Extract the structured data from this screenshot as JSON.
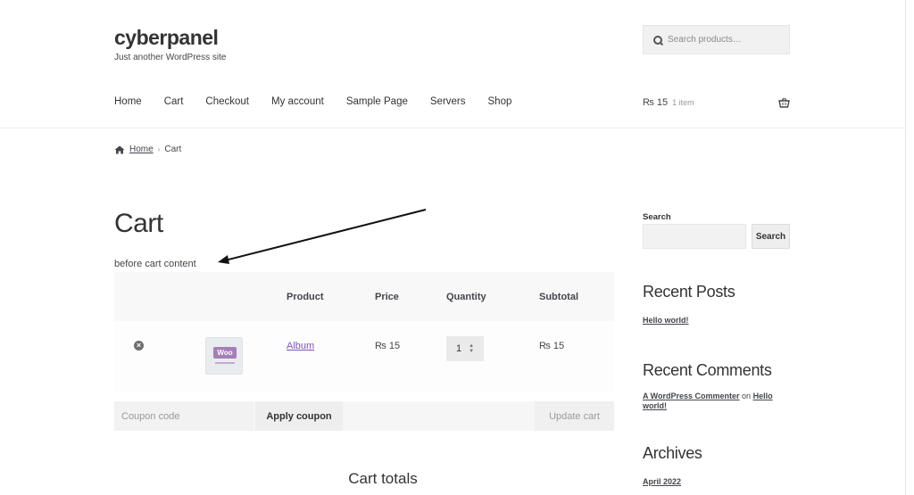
{
  "site": {
    "title": "cyberpanel",
    "tagline": "Just another WordPress site"
  },
  "header_search": {
    "placeholder": "Search products…"
  },
  "nav": [
    "Home",
    "Cart",
    "Checkout",
    "My account",
    "Sample Page",
    "Servers",
    "Shop"
  ],
  "mini_cart": {
    "amount": "₨ 15",
    "count": "1 item"
  },
  "breadcrumb": {
    "home": "Home",
    "sep": "›",
    "current": "Cart"
  },
  "page": {
    "title": "Cart",
    "before_cart": "before cart content"
  },
  "cart": {
    "headers": {
      "product": "Product",
      "price": "Price",
      "quantity": "Quantity",
      "subtotal": "Subtotal"
    },
    "items": [
      {
        "remove": "×",
        "thumb_label": "Woo",
        "name": "Album",
        "price": "₨ 15",
        "quantity": "1",
        "subtotal": "₨ 15"
      }
    ],
    "coupon_placeholder": "Coupon code",
    "apply_label": "Apply coupon",
    "update_label": "Update cart",
    "totals_title": "Cart totals"
  },
  "sidebar": {
    "search_label": "Search",
    "search_button": "Search",
    "recent_posts_title": "Recent Posts",
    "recent_posts": [
      "Hello world!"
    ],
    "recent_comments_title": "Recent Comments",
    "comment": {
      "author": "A WordPress Commenter",
      "on": "on",
      "post": "Hello world!"
    },
    "archives_title": "Archives",
    "archives": [
      "April 2022"
    ]
  },
  "colors": {
    "link_purple": "#7f54b3",
    "text": "#43454b",
    "heading": "#333333"
  }
}
